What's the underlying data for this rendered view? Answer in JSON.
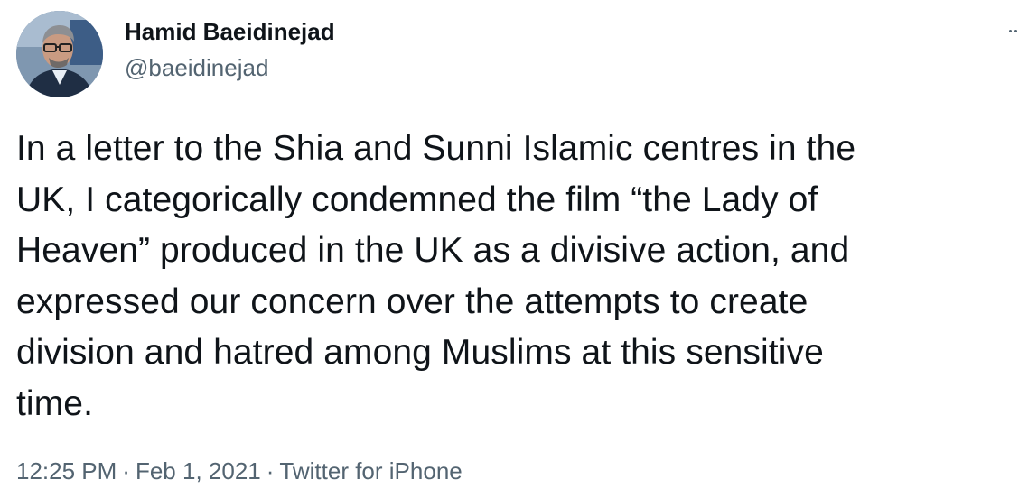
{
  "user": {
    "display_name": "Hamid Baeidinejad",
    "handle": "@baeidinejad",
    "avatar_icon": "profile-photo"
  },
  "tweet": {
    "text": "In a letter to the Shia and Sunni Islamic centres in the\nUK, I categorically condemned the film “the Lady of\nHeaven” produced in the UK as a divisive action, and\nexpressed our concern over the attempts to create\ndivision and hatred among Muslims at this sensitive\ntime."
  },
  "meta": {
    "time": "12:25 PM",
    "separator": "·",
    "date": "Feb 1, 2021",
    "source": "Twitter for iPhone"
  },
  "menu": {
    "icon": "more-icon"
  },
  "colors": {
    "text_primary": "#0f1419",
    "text_secondary": "#536471",
    "background": "#ffffff"
  }
}
